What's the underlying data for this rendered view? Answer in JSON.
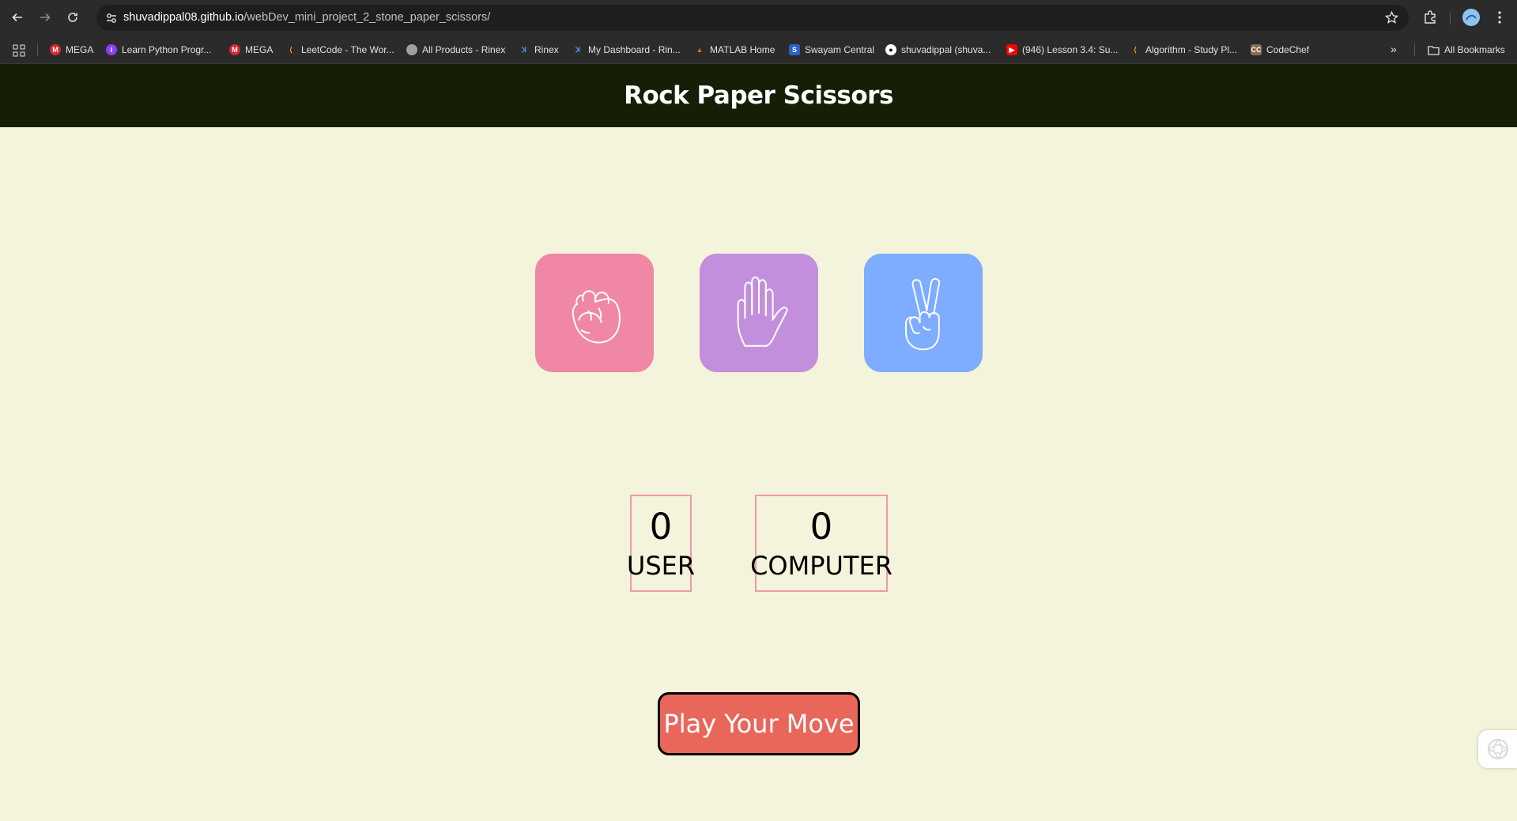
{
  "browser": {
    "url_host": "shuvadippal08.github.io",
    "url_path": "/webDev_mini_project_2_stone_paper_scissors/",
    "bookmarks": [
      {
        "label": "MEGA",
        "icon": "mega-icon",
        "color": "#d9272e"
      },
      {
        "label": "Learn Python Progr...",
        "icon": "learn-python-icon",
        "color": "#8a3ffc"
      },
      {
        "label": "MEGA",
        "icon": "mega-icon",
        "color": "#d9272e"
      },
      {
        "label": "LeetCode - The Wor...",
        "icon": "leetcode-icon",
        "color": "#ffa116"
      },
      {
        "label": "All Products - Rinex",
        "icon": "globe-icon",
        "color": "#9aa0a6"
      },
      {
        "label": "Rinex",
        "icon": "rinex-icon",
        "color": "#5b8def"
      },
      {
        "label": "My Dashboard - Rin...",
        "icon": "rinex-icon",
        "color": "#5b8def"
      },
      {
        "label": "MATLAB Home",
        "icon": "matlab-icon",
        "color": "#e16737"
      },
      {
        "label": "Swayam Central",
        "icon": "swayam-icon",
        "color": "#2a62c9"
      },
      {
        "label": "shuvadippal (shuva...",
        "icon": "github-icon",
        "color": "#ffffff"
      },
      {
        "label": "(946) Lesson 3.4: Su...",
        "icon": "youtube-icon",
        "color": "#ff0000"
      },
      {
        "label": "Algorithm - Study Pl...",
        "icon": "leetcode-icon",
        "color": "#ffa116"
      },
      {
        "label": "CodeChef",
        "icon": "codechef-icon",
        "color": "#8b6a4f"
      }
    ],
    "all_bookmarks": "All Bookmarks"
  },
  "page": {
    "title": "Rock Paper Scissors",
    "choices": [
      {
        "name": "rock",
        "icon": "fist-icon",
        "color": "#ef87a5"
      },
      {
        "name": "paper",
        "icon": "open-hand-icon",
        "color": "#c38fdc"
      },
      {
        "name": "scissors",
        "icon": "peace-hand-icon",
        "color": "#7eacff"
      }
    ],
    "scores": {
      "user_score": "0",
      "user_label": "USER",
      "computer_score": "0",
      "computer_label": "COMPUTER"
    },
    "message": "Play Your Move",
    "colors": {
      "header_bg": "#141f06",
      "page_bg": "#f4f4dc",
      "message_bg": "#e8675a",
      "score_border": "#ef9aa6"
    }
  }
}
